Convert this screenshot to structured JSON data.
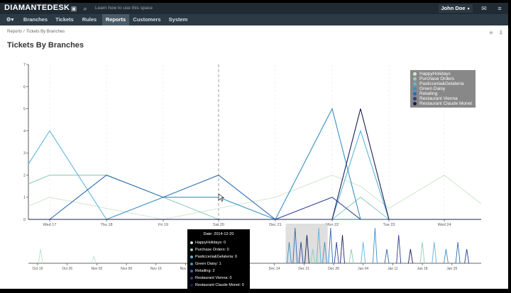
{
  "app": {
    "brand": "DIAMANTEDESK",
    "hint": "Learn how to use this space",
    "user": "John Doe",
    "nav": [
      "Branches",
      "Tickets",
      "Rules",
      "Reports",
      "Customers",
      "System"
    ],
    "active_nav": "Reports"
  },
  "breadcrumb": {
    "root": "Reports",
    "sep": "/",
    "current": "Tickets By Branches"
  },
  "page_title": "Tickets By Branches",
  "colors": {
    "HappyHolidays": "#d3e8cf",
    "Purchase Orders": "#8fcfb6",
    "Pasticceria&Gelateria": "#5fb4dc",
    "Green Daisy": "#3b90c4",
    "Retailing": "#2f6ab0",
    "Restaurant Vienna": "#2a3f96",
    "Restaurant Claude Monet": "#1c1f55"
  },
  "tooltip": {
    "date": "Date: 2014-12-20",
    "rows": [
      {
        "name": "HappyHolidays",
        "value": 0,
        "text": "HappyHolidays: 0"
      },
      {
        "name": "Purchase Orders",
        "value": 0,
        "text": "Purchase Orders: 0"
      },
      {
        "name": "Pasticceria&Gelateria",
        "value": 0,
        "text": "Pasticceria&Gelateria: 0"
      },
      {
        "name": "Green Daisy",
        "value": 1,
        "text": "Green Daisy: 1"
      },
      {
        "name": "Retailing",
        "value": 2,
        "text": "Retailing: 2"
      },
      {
        "name": "Restaurant Vienna",
        "value": 0,
        "text": "Restaurant Vienna: 0"
      },
      {
        "name": "Restaurant Claude Monet",
        "value": 0,
        "text": "Restaurant Claude Monet: 0"
      }
    ]
  },
  "chart_data": [
    {
      "type": "line",
      "x": [
        "Wed 17",
        "Thu 18",
        "Fri 19",
        "Sat 20",
        "Dec 21",
        "Mon 22",
        "Tue 23",
        "Wed 24"
      ],
      "ylim": [
        0,
        7
      ],
      "yticks": [
        1,
        2,
        3,
        4,
        5,
        6,
        7
      ],
      "legend": "top-right",
      "series": [
        {
          "name": "HappyHolidays",
          "values": [
            0.6,
            1,
            0.5,
            0,
            0.5,
            1,
            2,
            1.5,
            0.5,
            2,
            0.7
          ]
        },
        {
          "name": "Purchase Orders",
          "values": [
            1.6,
            2,
            2,
            1,
            0,
            0,
            0,
            1,
            0,
            0,
            0
          ]
        },
        {
          "name": "Pasticceria&Gelateria",
          "values": [
            2.5,
            4,
            0,
            0,
            0,
            0,
            0,
            4,
            0,
            0,
            0
          ]
        },
        {
          "name": "Green Daisy",
          "values": [
            0,
            0,
            0,
            1,
            1,
            0,
            5,
            0,
            0,
            0,
            0
          ]
        },
        {
          "name": "Retailing",
          "values": [
            0,
            0,
            2,
            1,
            2,
            0,
            0,
            0,
            0,
            0,
            0
          ]
        },
        {
          "name": "Restaurant Vienna",
          "values": [
            0,
            0,
            0,
            0,
            0,
            0,
            1,
            0,
            0,
            0,
            0
          ]
        },
        {
          "name": "Restaurant Claude Monet",
          "values": [
            0,
            0,
            0,
            0,
            0,
            0,
            0,
            5,
            0,
            0,
            0
          ]
        }
      ]
    },
    {
      "type": "line",
      "x": [
        "Oct 19",
        "Oct 26",
        "Nov 02",
        "Nov 09",
        "Nov 16",
        "Nov 23",
        "Nov 30",
        "Dec 07",
        "Dec 14",
        "Dec 21",
        "Dec 28",
        "Jan 04",
        "Jan 11",
        "Jan 18",
        "Jan 25"
      ],
      "spikes": [
        {
          "at": 0.1,
          "value": 2
        },
        {
          "at": 1.9,
          "value": 1
        },
        {
          "at": 8.5,
          "value": 3
        },
        {
          "at": 8.7,
          "value": 5
        },
        {
          "at": 8.9,
          "value": 3
        },
        {
          "at": 9.1,
          "value": 4
        },
        {
          "at": 9.3,
          "value": 2
        },
        {
          "at": 9.5,
          "value": 5
        },
        {
          "at": 9.7,
          "value": 3
        },
        {
          "at": 9.9,
          "value": 5
        },
        {
          "at": 10.1,
          "value": 3
        },
        {
          "at": 10.3,
          "value": 4
        },
        {
          "at": 10.6,
          "value": 2
        },
        {
          "at": 11.0,
          "value": 3
        },
        {
          "at": 11.4,
          "value": 5
        },
        {
          "at": 11.8,
          "value": 2
        },
        {
          "at": 12.2,
          "value": 4
        },
        {
          "at": 12.6,
          "value": 2
        },
        {
          "at": 13.0,
          "value": 3
        },
        {
          "at": 13.4,
          "value": 3
        },
        {
          "at": 13.8,
          "value": 2
        },
        {
          "at": 14.2,
          "value": 3
        },
        {
          "at": 14.5,
          "value": 2
        }
      ],
      "selection": [
        "Dec 14",
        "Dec 21"
      ]
    }
  ]
}
